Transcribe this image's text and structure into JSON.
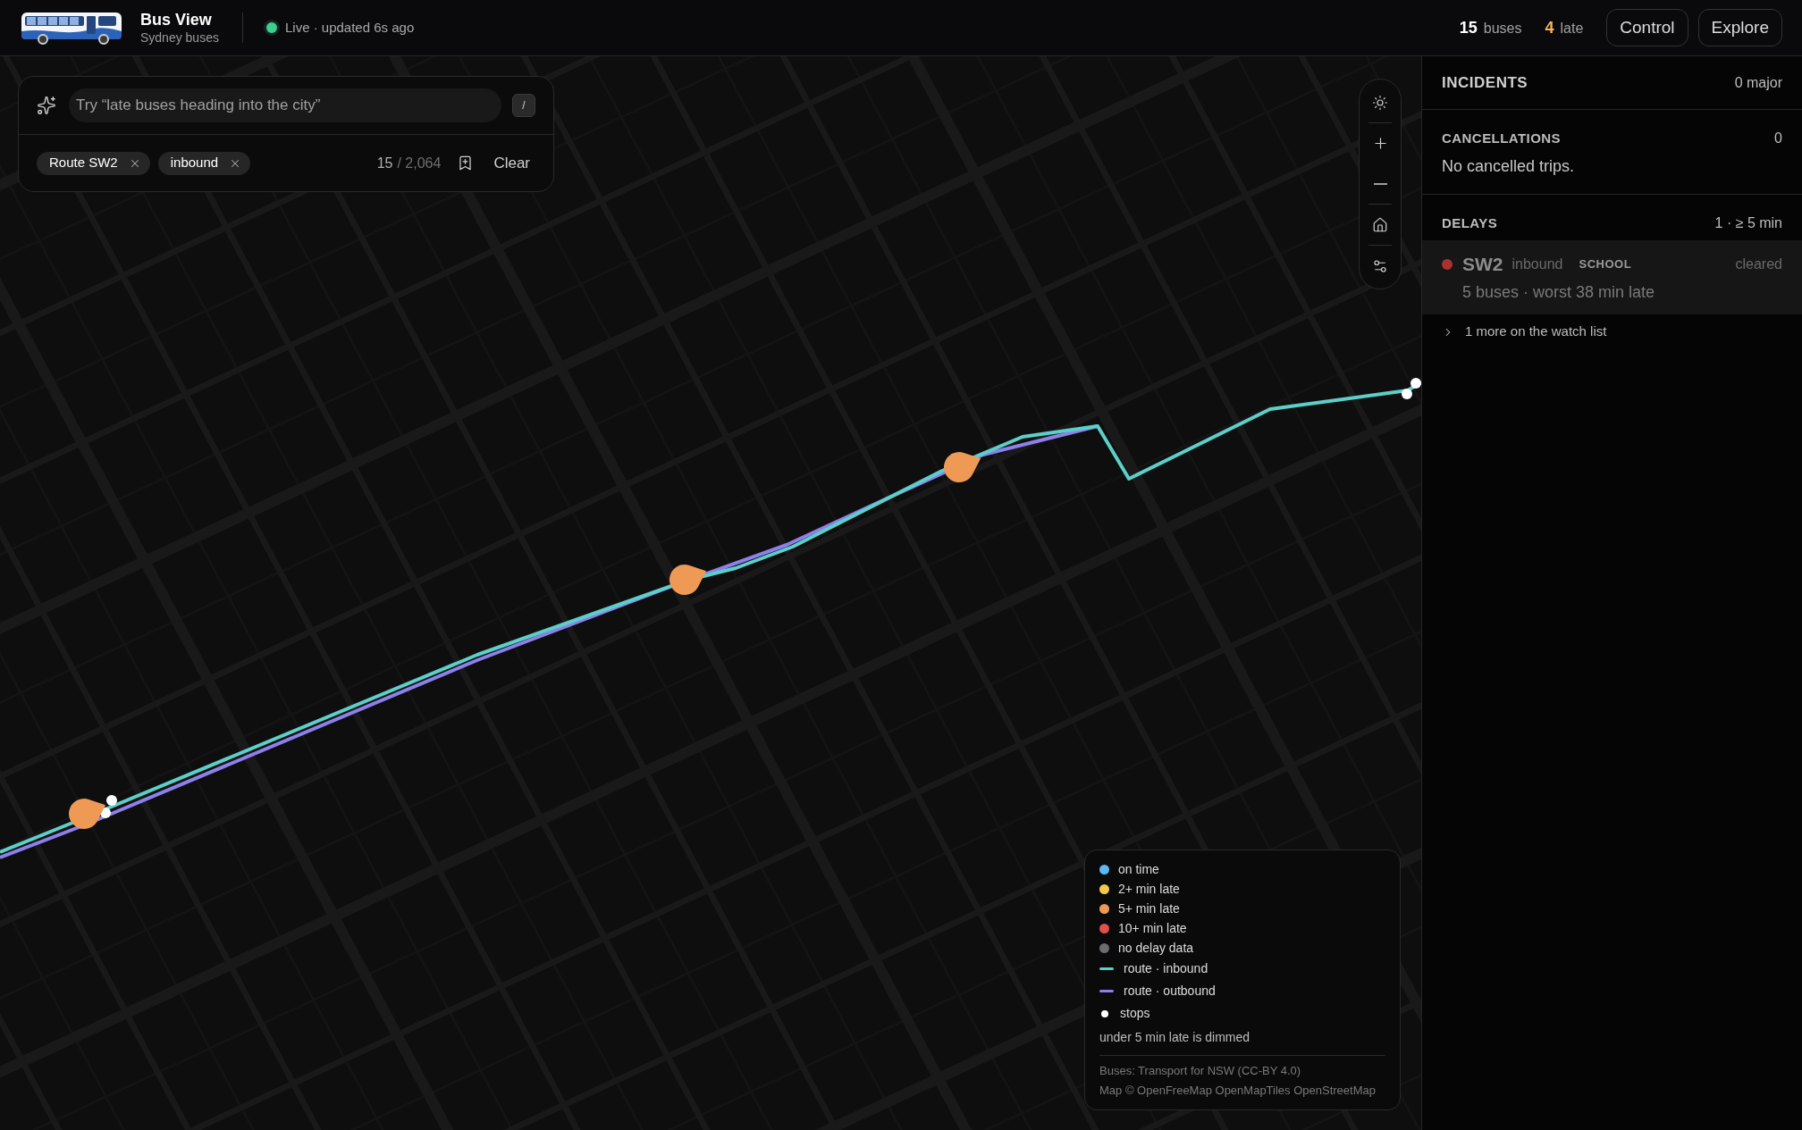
{
  "header": {
    "title": "Bus View",
    "subtitle": "Sydney buses",
    "live": {
      "on": true,
      "label": "Live · updated 6s ago"
    },
    "stats": [
      {
        "kind": "total",
        "count": "15",
        "unit": "buses"
      },
      {
        "kind": "late",
        "count": "4",
        "unit": "late"
      }
    ],
    "buttons": [
      "Control",
      "Explore"
    ]
  },
  "search": {
    "placeholder": "Try “late buses heading into the city”",
    "shortcut": "/",
    "filters": [
      "Route SW2",
      "inbound"
    ],
    "result_count": "15",
    "result_total": "/ 2,064",
    "clear": "Clear"
  },
  "map": {
    "buses": [
      {
        "color": "#ee9a55"
      },
      {
        "color": "#ee9a55"
      },
      {
        "color": "#ee9a55"
      }
    ]
  },
  "legend": {
    "items": [
      {
        "kind": "dot",
        "label": "on time",
        "color": "#5ab8f5"
      },
      {
        "kind": "dot",
        "label": "2+ min late",
        "color": "#f5c84a"
      },
      {
        "kind": "dot",
        "label": "5+ min late",
        "color": "#ee9a55"
      },
      {
        "kind": "dot",
        "label": "10+ min late",
        "color": "#e0504d"
      },
      {
        "kind": "dot",
        "label": "no delay data",
        "color": "#6b6b70"
      },
      {
        "kind": "line",
        "label": "route · inbound",
        "color": "#5ccfc8"
      },
      {
        "kind": "line",
        "label": "route · outbound",
        "color": "#8d80ea"
      },
      {
        "kind": "stop",
        "label": "stops",
        "color": "#ffffff"
      }
    ],
    "note": "under 5 min late is dimmed",
    "credits": [
      "Buses: Transport for NSW (CC-BY 4.0)",
      "Map © OpenFreeMap OpenMapTiles OpenStreetMap"
    ]
  },
  "incidents": {
    "title": "INCIDENTS",
    "summary": "0 major",
    "cancellations": {
      "title": "CANCELLATIONS",
      "count": "0",
      "empty_text": "No cancelled trips."
    },
    "delays": {
      "title": "DELAYS",
      "summary": "1 · ≥ 5 min",
      "items": [
        {
          "route": "SW2",
          "direction": "inbound",
          "tag": "SCHOOL",
          "status": "cleared",
          "detail": "5 buses · worst 38 min late",
          "color": "#a83232",
          "dimmed": true
        }
      ],
      "more": {
        "label": "1 more on the watch list",
        "expanded": false
      }
    }
  }
}
